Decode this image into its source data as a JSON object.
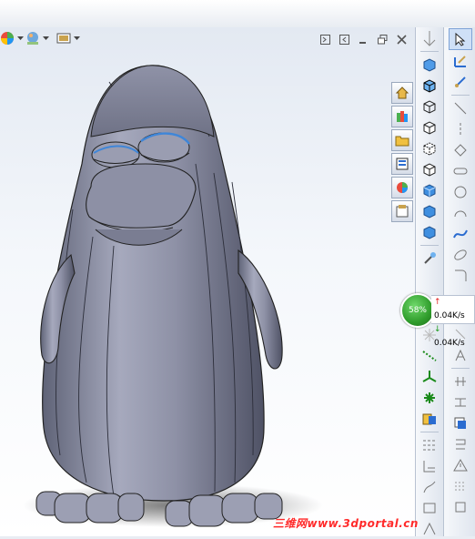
{
  "viewport": {
    "model_name": "",
    "background_top": "#e3e9f2",
    "background_bottom": "#ffffff"
  },
  "heads_up_toolbar": {
    "items": [
      {
        "name": "appearance-icon"
      },
      {
        "name": "scene-icon"
      },
      {
        "name": "display-settings-icon"
      }
    ]
  },
  "window_controls": [
    "restore-left",
    "restore-right",
    "restore-icon",
    "tile-icon",
    "close-icon"
  ],
  "task_pane_tabs": [
    "home-icon",
    "design-library-icon",
    "file-explorer-icon",
    "view-palette-icon",
    "appearances-icon",
    "custom-properties-icon"
  ],
  "network_monitor": {
    "percent": "58%",
    "upload": "0.04K/s",
    "download": "0.04K/s",
    "level": 0.58
  },
  "watermark": {
    "text": "三维网www.3dportal.cn",
    "color": "#ff2a2a"
  }
}
